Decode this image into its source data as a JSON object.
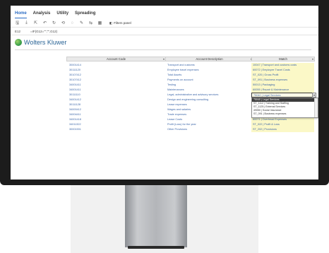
{
  "ribbon": {
    "tabs": [
      "Home",
      "Analysis",
      "Utility",
      "Spreading"
    ],
    "active_tab": "Home"
  },
  "toolbar": {
    "filters_label": "Filters panel"
  },
  "formula_bar": {
    "cell_ref": "E12",
    "formula": "=IF(G12=\"\",\"\",G12)"
  },
  "logo": {
    "text": "Wolters Kluwer"
  },
  "grid": {
    "headers": {
      "code": "Account Code",
      "desc": "Account Description",
      "match": "Match"
    },
    "rows": [
      {
        "code": "30001414",
        "desc": "Transport and customs",
        "match": "10047 | Transport and customs costs"
      },
      {
        "code": "30111120",
        "desc": "Employee travel expenses",
        "match": "60072 | Employee Travel Costs"
      },
      {
        "code": "30107412",
        "desc": "Total Assets",
        "match": "ST_020 | Gross Profit"
      },
      {
        "code": "30107412",
        "desc": "Payments on account",
        "match": "ST_091 | Business expenses"
      },
      {
        "code": "34001411",
        "desc": "Testing",
        "match": "50013 | Packaging"
      },
      {
        "code": "34001411",
        "desc": "Maintenances",
        "match": "60055 | Repair & Maintenance"
      },
      {
        "code": "30111110",
        "desc": "Legal, administrative and advisory services",
        "match": "75040 | Legal Services"
      },
      {
        "code": "34001412",
        "desc": "Design and engineering consulting",
        "match": ""
      },
      {
        "code": "30111128",
        "desc": "Lease expenses",
        "match": ""
      },
      {
        "code": "34000412",
        "desc": "Wages and salaries",
        "match": ""
      },
      {
        "code": "34004411",
        "desc": "Trade expenses",
        "match": ""
      },
      {
        "code": "34001418",
        "desc": "Lease Costs",
        "match": "60071 | Overhead Expenses"
      },
      {
        "code": "34011322",
        "desc": "Profit (Loss) for the year",
        "match": "ST_022 | Profit & Loss"
      },
      {
        "code": "30001901",
        "desc": "Other Provisions",
        "match": "ST_202 | Provisions"
      }
    ],
    "active_row_value": "75040 | Legal Services",
    "dropdown_options": [
      "75040 | Legal Services",
      "ST_1112 | Training and Staffing",
      "ST_1125 | External Services",
      "49050 | Social Insurance",
      "ST_091 | Business expenses"
    ]
  }
}
